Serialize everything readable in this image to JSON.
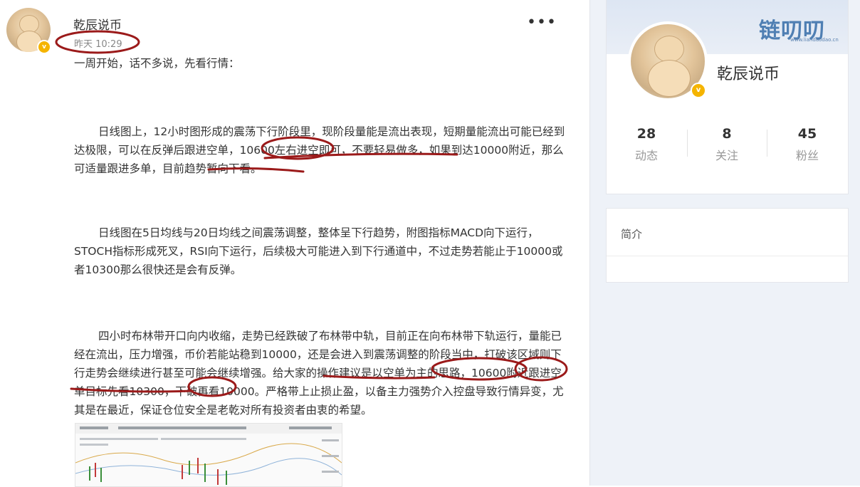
{
  "post": {
    "author": "乾辰说币",
    "time": "昨天 10:29",
    "more_icon": "more-dots-icon",
    "paragraphs": [
      "一周开始，话不多说，先看行情：",
      "日线图上，12小时图形成的震荡下行阶段里，现阶段量能是流出表现，短期量能流出可能已经到达极限，可以在反弹后跟进空单，10600左右进空即可，不要轻易做多，如果到达10000附近，那么可适量跟进多单，目前趋势暂向下看。",
      "日线图在5日均线与20日均线之间震荡调整，整体呈下行趋势，附图指标MACD向下运行，STOCH指标形成死叉，RSI向下运行，后续极大可能进入到下行通道中，不过走势若能止于10000或者10300那么很快还是会有反弹。",
      "四小时布林带开口向内收缩，走势已经跌破了布林带中轨，目前正在向布林带下轨运行，量能已经在流出，压力增强，币价若能站稳到10000，还是会进入到震荡调整的阶段当中，打破该区域则下行走势会继续进行甚至可能会继续增强。给大家的操作建议是以空单为主的思路，10600附近跟进空单目标先看10300，下破再看10000。严格带上止损止盈，以备主力强势介入控盘导致行情异变，尤其是在最近，保证仓位安全是老乾对所有投资者由衷的希望。"
    ]
  },
  "profile": {
    "watermark": "链叨叨",
    "watermark_sub": "www.liandaodao.cn",
    "name": "乾辰说币",
    "stats": [
      {
        "num": "28",
        "label": "动态"
      },
      {
        "num": "8",
        "label": "关注"
      },
      {
        "num": "45",
        "label": "粉丝"
      }
    ]
  },
  "intro": {
    "title": "简介"
  },
  "colors": {
    "annotation_red": "#9b1a1a",
    "verified_badge": "#f5b400",
    "sidebar_bg": "#eef2f8"
  }
}
